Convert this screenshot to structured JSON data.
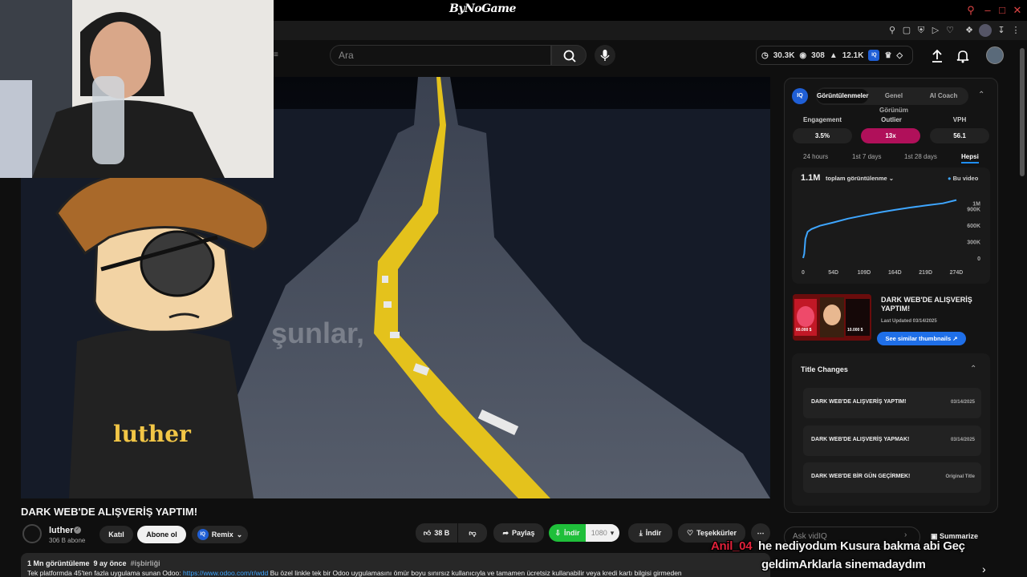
{
  "window": {
    "brand": "ByNoGame",
    "controls": [
      "search-icon",
      "minimize-icon",
      "maximize-icon",
      "close-icon"
    ]
  },
  "header": {
    "search_placeholder": "Ara",
    "stats": {
      "views": "30.3K",
      "watching": "308",
      "likes": "12.1K"
    }
  },
  "video": {
    "subtitle": "şunlar,",
    "shirt_text": "luther"
  },
  "below": {
    "title": "DARK WEB'DE ALIŞVERİŞ YAPTIM!",
    "channel_name": "luther",
    "subs": "306 B abone",
    "join": "Katıl",
    "subscribe": "Abone ol",
    "remix": "Remix",
    "likes": "38 B",
    "share": "Paylaş",
    "dl_ext": "İndir",
    "quality": "1080",
    "download": "İndir",
    "thanks": "Teşekkürler",
    "views_line": "1 Mn görüntüleme",
    "age": "9 ay önce",
    "tag": "#işbirliği",
    "desc_prefix": "Tek platformda 45'ten fazla uygulama sunan Odoo: ",
    "desc_link": "https://www.odoo.com/r/wdd",
    "desc_rest": " Bu özel linkle tek bir Odoo uygulamasını ömür boyu sınırsız kullanıcıyla ve tamamen ücretsiz kullanabilir veya kredi kartı bilgisi girmeden"
  },
  "panel": {
    "logo": "IQ",
    "tabs": [
      "Görüntülenmeler",
      "Genel Görünüm",
      "AI Coach"
    ],
    "metrics": [
      {
        "label": "Engagement",
        "value": "3.5%"
      },
      {
        "label": "Outlier",
        "value": "13x"
      },
      {
        "label": "VPH",
        "value": "56.1"
      }
    ],
    "ranges": [
      "24 hours",
      "1st 7 days",
      "1st 28 days",
      "Hepsi"
    ],
    "chart_total": "1.1M",
    "chart_metric": "toplam görüntülenme",
    "legend": "Bu video",
    "thumb_title": "DARK WEB'DE ALIŞVERİŞ YAPTIM!",
    "last_updated": "Last Updated 03/14/2025",
    "similar_btn": "See similar thumbnails",
    "title_changes_hdr": "Title Changes",
    "title_changes": [
      {
        "title": "DARK WEB'DE ALIŞVERİŞ YAPTIM!",
        "date": "03/14/2025"
      },
      {
        "title": "DARK WEB'DE ALIŞVERİŞ YAPMAK!",
        "date": "03/14/2025"
      },
      {
        "title": "DARK WEB'DE BİR GÜN GEÇİRMEK!",
        "date": "Original Title"
      }
    ],
    "thumb_prices": [
      "60.000 $",
      "10.000 $"
    ]
  },
  "chart_data": {
    "type": "line",
    "title": "",
    "x_ticks": [
      "0",
      "54D",
      "109D",
      "164D",
      "219D",
      "274D"
    ],
    "y_ticks": [
      "1M",
      "900K",
      "600K",
      "300K",
      "0"
    ],
    "ylim": [
      0,
      1200000
    ],
    "xlim": [
      0,
      274
    ],
    "series": [
      {
        "name": "Bu video",
        "x": [
          0,
          2,
          4,
          8,
          15,
          30,
          54,
          80,
          109,
          140,
          164,
          190,
          219,
          250,
          274
        ],
        "y": [
          0,
          80000,
          350000,
          480000,
          530000,
          590000,
          650000,
          720000,
          780000,
          840000,
          880000,
          920000,
          960000,
          1000000,
          1060000
        ]
      }
    ],
    "grid": false,
    "legend": "top-right"
  },
  "bottom": {
    "ask_placeholder": "Ask vidIQ",
    "summarize": "Summarize"
  },
  "chat": {
    "user": "Anil_04",
    "msg1": "he nediyodum Kusura bakma abi Geç",
    "msg2": "geldimArklarla sinemadaydım"
  },
  "colors": {
    "accent_red": "#b0105a",
    "blue": "#1f6fe8",
    "chat_user": "#e0213a"
  }
}
